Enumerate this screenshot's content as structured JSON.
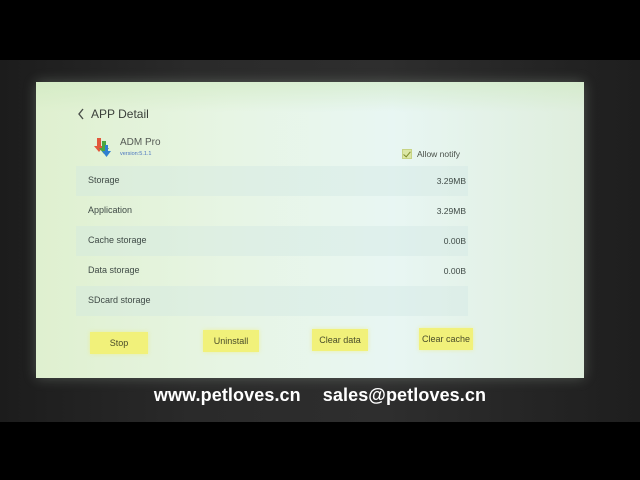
{
  "header": {
    "title": "APP Detail"
  },
  "app": {
    "name": "ADM Pro",
    "version": "version:5.1.1"
  },
  "notify": {
    "label": "Allow notify",
    "checked": true
  },
  "rows": [
    {
      "label": "Storage",
      "value": "3.29MB"
    },
    {
      "label": "Application",
      "value": "3.29MB"
    },
    {
      "label": "Cache storage",
      "value": "0.00B"
    },
    {
      "label": "Data storage",
      "value": "0.00B"
    },
    {
      "label": "SDcard storage",
      "value": ""
    }
  ],
  "buttons": {
    "stop": "Stop",
    "uninstall": "Uninstall",
    "clear_data": "Clear data",
    "clear_cache": "Clear cache"
  },
  "footer": {
    "website": "www.petloves.cn",
    "email": "sales@petloves.cn"
  },
  "colors": {
    "button_bg": "#f1f17a",
    "version_text": "#4b76c0",
    "footer_text": "#ffffff"
  }
}
